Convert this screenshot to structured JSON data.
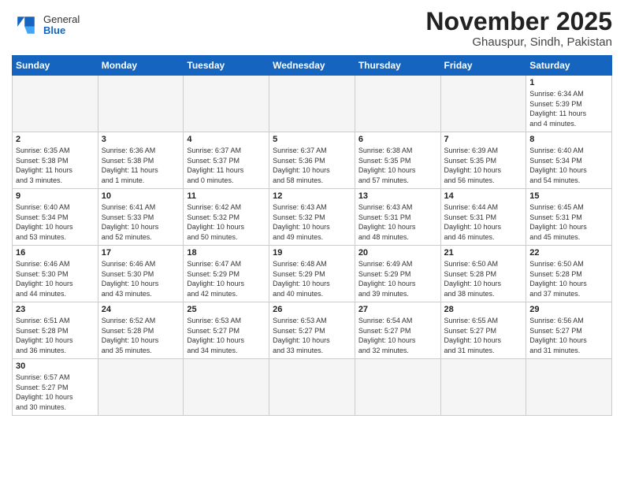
{
  "header": {
    "logo_general": "General",
    "logo_blue": "Blue",
    "month_title": "November 2025",
    "location": "Ghauspur, Sindh, Pakistan"
  },
  "weekdays": [
    "Sunday",
    "Monday",
    "Tuesday",
    "Wednesday",
    "Thursday",
    "Friday",
    "Saturday"
  ],
  "weeks": [
    [
      {
        "day": "",
        "info": ""
      },
      {
        "day": "",
        "info": ""
      },
      {
        "day": "",
        "info": ""
      },
      {
        "day": "",
        "info": ""
      },
      {
        "day": "",
        "info": ""
      },
      {
        "day": "",
        "info": ""
      },
      {
        "day": "1",
        "info": "Sunrise: 6:34 AM\nSunset: 5:39 PM\nDaylight: 11 hours\nand 4 minutes."
      }
    ],
    [
      {
        "day": "2",
        "info": "Sunrise: 6:35 AM\nSunset: 5:38 PM\nDaylight: 11 hours\nand 3 minutes."
      },
      {
        "day": "3",
        "info": "Sunrise: 6:36 AM\nSunset: 5:38 PM\nDaylight: 11 hours\nand 1 minute."
      },
      {
        "day": "4",
        "info": "Sunrise: 6:37 AM\nSunset: 5:37 PM\nDaylight: 11 hours\nand 0 minutes."
      },
      {
        "day": "5",
        "info": "Sunrise: 6:37 AM\nSunset: 5:36 PM\nDaylight: 10 hours\nand 58 minutes."
      },
      {
        "day": "6",
        "info": "Sunrise: 6:38 AM\nSunset: 5:35 PM\nDaylight: 10 hours\nand 57 minutes."
      },
      {
        "day": "7",
        "info": "Sunrise: 6:39 AM\nSunset: 5:35 PM\nDaylight: 10 hours\nand 56 minutes."
      },
      {
        "day": "8",
        "info": "Sunrise: 6:40 AM\nSunset: 5:34 PM\nDaylight: 10 hours\nand 54 minutes."
      }
    ],
    [
      {
        "day": "9",
        "info": "Sunrise: 6:40 AM\nSunset: 5:34 PM\nDaylight: 10 hours\nand 53 minutes."
      },
      {
        "day": "10",
        "info": "Sunrise: 6:41 AM\nSunset: 5:33 PM\nDaylight: 10 hours\nand 52 minutes."
      },
      {
        "day": "11",
        "info": "Sunrise: 6:42 AM\nSunset: 5:32 PM\nDaylight: 10 hours\nand 50 minutes."
      },
      {
        "day": "12",
        "info": "Sunrise: 6:43 AM\nSunset: 5:32 PM\nDaylight: 10 hours\nand 49 minutes."
      },
      {
        "day": "13",
        "info": "Sunrise: 6:43 AM\nSunset: 5:31 PM\nDaylight: 10 hours\nand 48 minutes."
      },
      {
        "day": "14",
        "info": "Sunrise: 6:44 AM\nSunset: 5:31 PM\nDaylight: 10 hours\nand 46 minutes."
      },
      {
        "day": "15",
        "info": "Sunrise: 6:45 AM\nSunset: 5:31 PM\nDaylight: 10 hours\nand 45 minutes."
      }
    ],
    [
      {
        "day": "16",
        "info": "Sunrise: 6:46 AM\nSunset: 5:30 PM\nDaylight: 10 hours\nand 44 minutes."
      },
      {
        "day": "17",
        "info": "Sunrise: 6:46 AM\nSunset: 5:30 PM\nDaylight: 10 hours\nand 43 minutes."
      },
      {
        "day": "18",
        "info": "Sunrise: 6:47 AM\nSunset: 5:29 PM\nDaylight: 10 hours\nand 42 minutes."
      },
      {
        "day": "19",
        "info": "Sunrise: 6:48 AM\nSunset: 5:29 PM\nDaylight: 10 hours\nand 40 minutes."
      },
      {
        "day": "20",
        "info": "Sunrise: 6:49 AM\nSunset: 5:29 PM\nDaylight: 10 hours\nand 39 minutes."
      },
      {
        "day": "21",
        "info": "Sunrise: 6:50 AM\nSunset: 5:28 PM\nDaylight: 10 hours\nand 38 minutes."
      },
      {
        "day": "22",
        "info": "Sunrise: 6:50 AM\nSunset: 5:28 PM\nDaylight: 10 hours\nand 37 minutes."
      }
    ],
    [
      {
        "day": "23",
        "info": "Sunrise: 6:51 AM\nSunset: 5:28 PM\nDaylight: 10 hours\nand 36 minutes."
      },
      {
        "day": "24",
        "info": "Sunrise: 6:52 AM\nSunset: 5:28 PM\nDaylight: 10 hours\nand 35 minutes."
      },
      {
        "day": "25",
        "info": "Sunrise: 6:53 AM\nSunset: 5:27 PM\nDaylight: 10 hours\nand 34 minutes."
      },
      {
        "day": "26",
        "info": "Sunrise: 6:53 AM\nSunset: 5:27 PM\nDaylight: 10 hours\nand 33 minutes."
      },
      {
        "day": "27",
        "info": "Sunrise: 6:54 AM\nSunset: 5:27 PM\nDaylight: 10 hours\nand 32 minutes."
      },
      {
        "day": "28",
        "info": "Sunrise: 6:55 AM\nSunset: 5:27 PM\nDaylight: 10 hours\nand 31 minutes."
      },
      {
        "day": "29",
        "info": "Sunrise: 6:56 AM\nSunset: 5:27 PM\nDaylight: 10 hours\nand 31 minutes."
      }
    ],
    [
      {
        "day": "30",
        "info": "Sunrise: 6:57 AM\nSunset: 5:27 PM\nDaylight: 10 hours\nand 30 minutes."
      },
      {
        "day": "",
        "info": ""
      },
      {
        "day": "",
        "info": ""
      },
      {
        "day": "",
        "info": ""
      },
      {
        "day": "",
        "info": ""
      },
      {
        "day": "",
        "info": ""
      },
      {
        "day": "",
        "info": ""
      }
    ]
  ]
}
